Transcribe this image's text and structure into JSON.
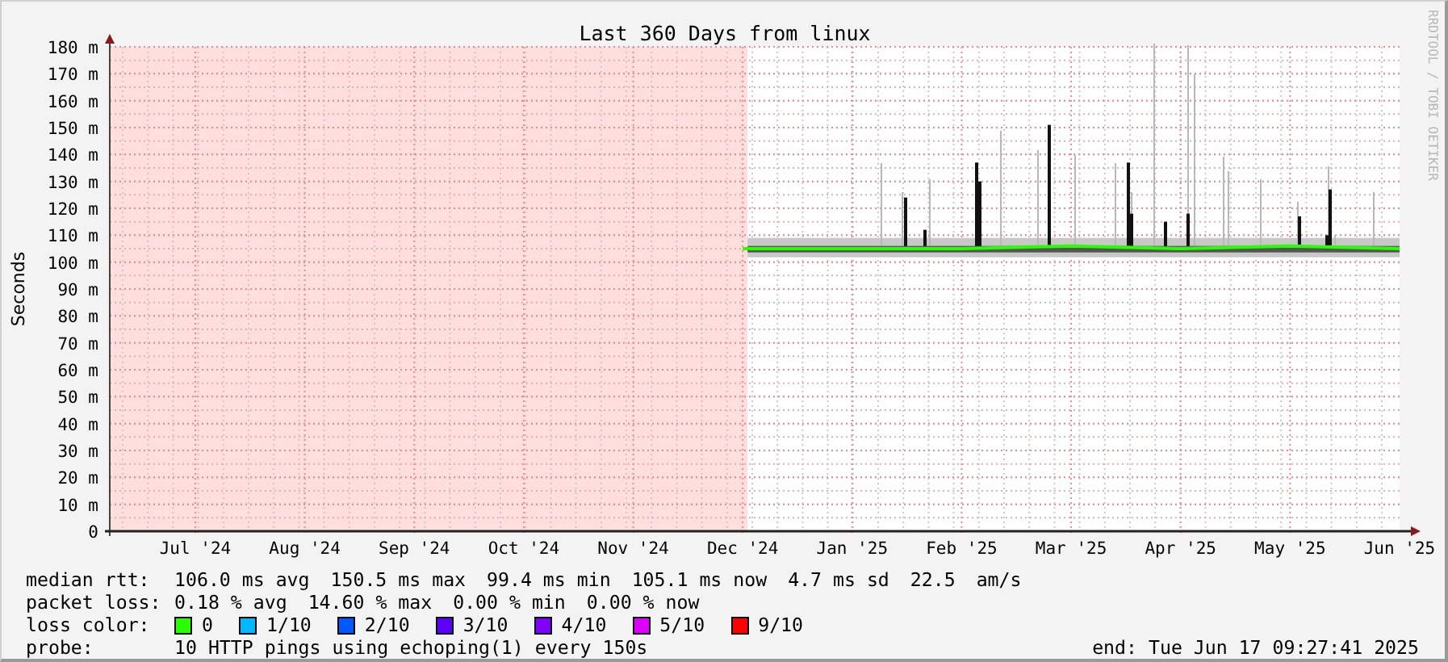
{
  "title": "Last 360 Days from linux",
  "credit": "RRDTOOL / TOBI OETIKER",
  "chart_data": {
    "type": "line",
    "ylabel": "Seconds",
    "categories": [
      "Jul '24",
      "Aug '24",
      "Sep '24",
      "Oct '24",
      "Nov '24",
      "Dec '24",
      "Jan '25",
      "Feb '25",
      "Mar '25",
      "Apr '25",
      "May '25",
      "Jun '25"
    ],
    "series": [
      {
        "color": "#26ff00",
        "values": [
          null,
          null,
          null,
          null,
          null,
          105,
          105,
          105,
          106,
          105,
          106,
          105
        ]
      }
    ],
    "ylim": [
      0,
      180
    ],
    "grid": true,
    "yticks": [
      {
        "value": 0,
        "label": "0"
      },
      {
        "value": 10,
        "label": "10 m"
      },
      {
        "value": 20,
        "label": "20 m"
      },
      {
        "value": 30,
        "label": "30 m"
      },
      {
        "value": 40,
        "label": "40 m"
      },
      {
        "value": 50,
        "label": "50 m"
      },
      {
        "value": 60,
        "label": "60 m"
      },
      {
        "value": 70,
        "label": "70 m"
      },
      {
        "value": 80,
        "label": "80 m"
      },
      {
        "value": 90,
        "label": "90 m"
      },
      {
        "value": 100,
        "label": "100 m"
      },
      {
        "value": 110,
        "label": "110 m"
      },
      {
        "value": 120,
        "label": "120 m"
      },
      {
        "value": 130,
        "label": "130 m"
      },
      {
        "value": 140,
        "label": "140 m"
      },
      {
        "value": 150,
        "label": "150 m"
      },
      {
        "value": 160,
        "label": "160 m"
      },
      {
        "value": 170,
        "label": "170 m"
      },
      {
        "value": 180,
        "label": "180 m"
      }
    ]
  },
  "legend": {
    "median_rtt": {
      "label": "median rtt:",
      "stats": [
        "106.0 ms avg",
        "150.5 ms max",
        "99.4 ms min",
        "105.1 ms now",
        "4.7 ms sd",
        "22.5",
        "am/s"
      ]
    },
    "packet_loss": {
      "label": "packet loss:",
      "stats": [
        "0.18 % avg",
        "14.60 % max",
        "0.00 % min",
        "0.00 % now"
      ]
    },
    "loss_color": {
      "label": "loss color:",
      "items": [
        {
          "label": "0",
          "color": "#26ff00"
        },
        {
          "label": "1/10",
          "color": "#00b8ff"
        },
        {
          "label": "2/10",
          "color": "#0059ff"
        },
        {
          "label": "3/10",
          "color": "#5e00ff"
        },
        {
          "label": "4/10",
          "color": "#7e00ff"
        },
        {
          "label": "5/10",
          "color": "#dd00ff"
        },
        {
          "label": "9/10",
          "color": "#ff0000"
        }
      ]
    },
    "probe": {
      "label": "probe:",
      "text": "10 HTTP pings using echoping(1) every 150s"
    },
    "end": "end: Tue Jun 17 09:27:41 2025"
  }
}
